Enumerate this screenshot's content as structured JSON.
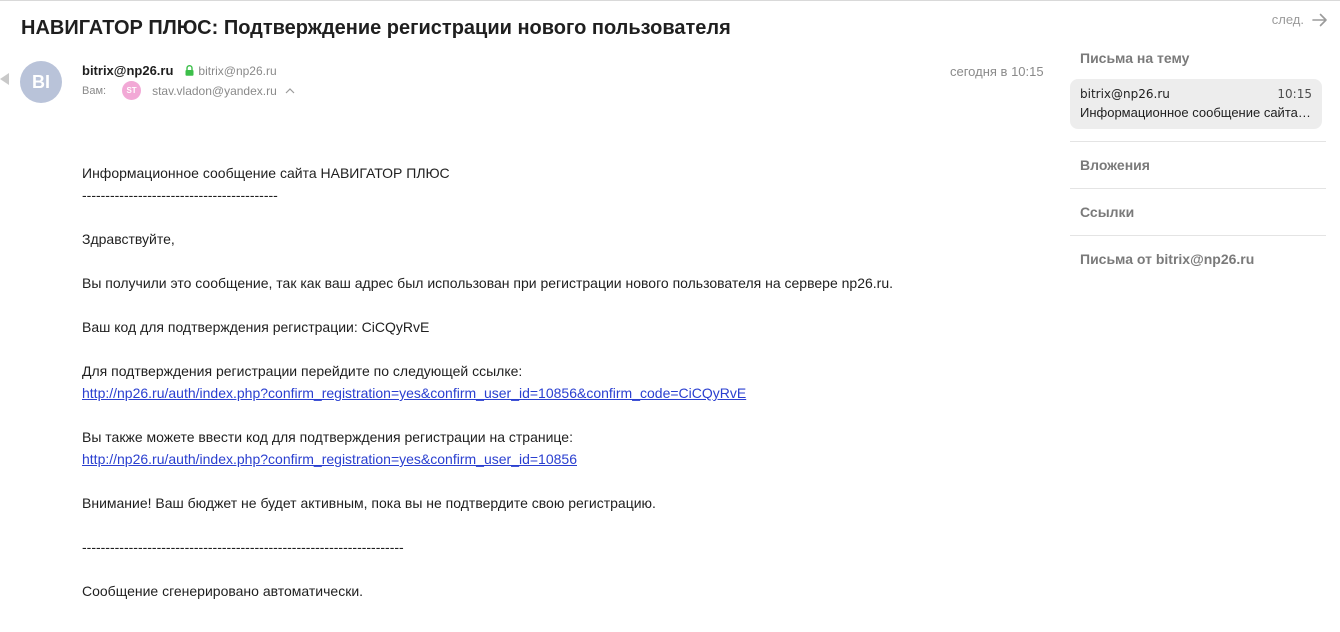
{
  "email": {
    "subject": "НАВИГАТОР ПЛЮС: Подтверждение регистрации нового пользователя",
    "next_label": "след.",
    "sender": {
      "avatar_initials": "BI",
      "name": "bitrix@np26.ru",
      "email": "bitrix@np26.ru"
    },
    "date": "сегодня в 10:15",
    "recipient": {
      "label": "Вам:",
      "avatar_initials": "ST",
      "email": "stav.vladon@yandex.ru"
    },
    "body": {
      "line1": "Информационное сообщение сайта НАВИГАТОР ПЛЮС",
      "sep1": "------------------------------------------",
      "greeting": "Здравствуйте,",
      "line2": "Вы получили это сообщение, так как ваш адрес был использован при регистрации нового пользователя на сервере np26.ru.",
      "code_line": "Ваш код для подтверждения регистрации: CiCQyRvE",
      "confirm_intro": "Для подтверждения регистрации перейдите по следующей ссылке:",
      "confirm_link": "http://np26.ru/auth/index.php?confirm_registration=yes&confirm_user_id=10856&confirm_code=CiCQyRvE",
      "page_intro": "Вы также можете ввести код для подтверждения регистрации на странице:",
      "page_link": "http://np26.ru/auth/index.php?confirm_registration=yes&confirm_user_id=10856",
      "warning": "Внимание! Ваш бюджет не будет активным, пока вы не подтвердите свою регистрацию.",
      "sep2": "---------------------------------------------------------------------",
      "footer": "Сообщение сгенерировано автоматически."
    }
  },
  "sidebar": {
    "thread_heading": "Письма на тему",
    "thread": {
      "from": "bitrix@np26.ru",
      "time": "10:15",
      "snippet": "Информационное сообщение сайта НАВИГАТОР ПЛЮС"
    },
    "sections": [
      "Вложения",
      "Ссылки",
      "Письма от bitrix@np26.ru"
    ]
  },
  "colors": {
    "link": "#2a3fd0",
    "avatar_sender": "#b9c3d9",
    "avatar_recipient": "#f2a9d6",
    "lock": "#3cbf4a"
  },
  "icons": {
    "next": "arrow-right-icon",
    "secure": "lock-icon",
    "expand": "chevron-up-icon"
  }
}
